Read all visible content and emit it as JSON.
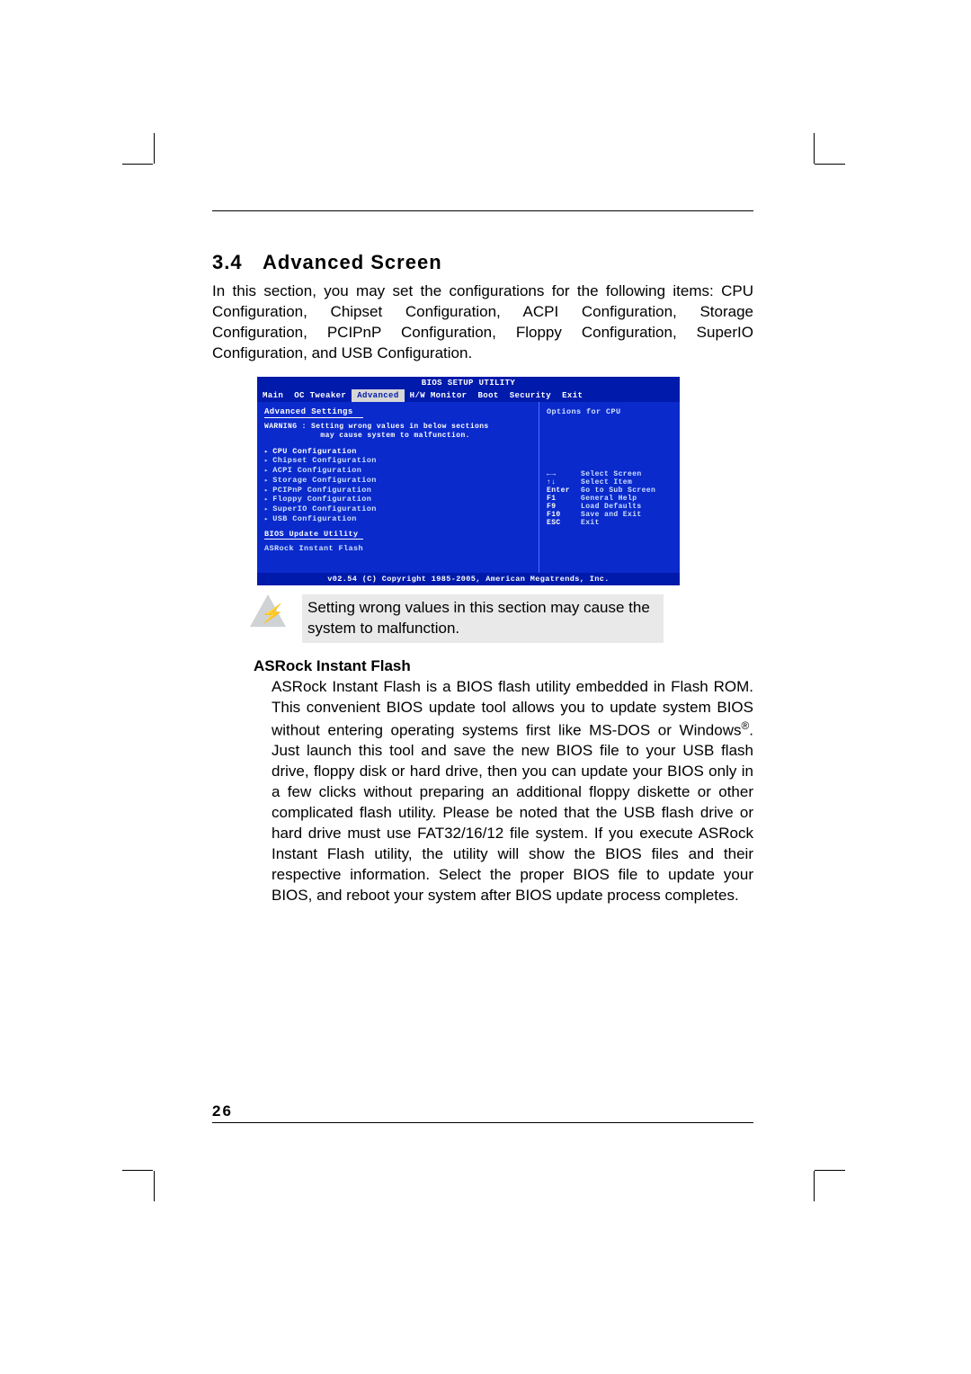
{
  "page_number": "26",
  "section": {
    "num": "3.4",
    "title": "Advanced Screen",
    "intro": "In this section, you may set the configurations for the following items: CPU Configuration, Chipset Configuration, ACPI Configuration, Storage Configuration, PCIPnP Configuration, Floppy Configuration, SuperIO Configuration, and USB Configuration."
  },
  "bios": {
    "title": "BIOS SETUP UTILITY",
    "tabs": {
      "main": "Main",
      "oc": "OC Tweaker",
      "advanced": "Advanced",
      "hw": "H/W Monitor",
      "boot": "Boot",
      "security": "Security",
      "exit": "Exit"
    },
    "left": {
      "header": "Advanced Settings",
      "warning_l1": "WARNING : Setting wrong values in below sections",
      "warning_l2": "may cause system to malfunction.",
      "items": {
        "cpu": "CPU Configuration",
        "chipset": "Chipset Configuration",
        "acpi": "ACPI Configuration",
        "storage": "Storage Configuration",
        "pcipnp": "PCIPnP Configuration",
        "floppy": "Floppy Configuration",
        "superio": "SuperIO Configuration",
        "usb": "USB Configuration"
      },
      "update_util": "BIOS Update Utility",
      "flash": "ASRock Instant Flash"
    },
    "right": {
      "opt_title": "Options for CPU",
      "keys": {
        "lr": {
          "k": "←→",
          "v": "Select Screen"
        },
        "ud": {
          "k": "↑↓",
          "v": "Select Item"
        },
        "enter": {
          "k": "Enter",
          "v": "Go to Sub Screen"
        },
        "f1": {
          "k": "F1",
          "v": "General Help"
        },
        "f9": {
          "k": "F9",
          "v": "Load Defaults"
        },
        "f10": {
          "k": "F10",
          "v": "Save and Exit"
        },
        "esc": {
          "k": "ESC",
          "v": "Exit"
        }
      }
    },
    "footer": "v02.54 (C) Copyright 1985-2005, American Megatrends, Inc."
  },
  "callout": "Setting wrong values in this section may cause the system to malfunction.",
  "asrock": {
    "heading": "ASRock Instant Flash",
    "body_a": "ASRock Instant Flash is a BIOS flash utility embedded in Flash ROM. This convenient BIOS update tool allows you to update system BIOS without entering operating systems first like MS-DOS or Windows",
    "body_b": ". Just launch this tool and save the new BIOS file to your USB flash drive, floppy disk or hard drive, then you can update your BIOS only in a few clicks without preparing an additional floppy diskette or other complicated flash utility. Please be noted that the USB flash drive or hard drive must use FAT32/16/12 file system. If you execute ASRock Instant Flash utility, the utility will show the BIOS files and their respective information. Select the proper BIOS file to update your BIOS, and reboot your system after BIOS update process completes."
  }
}
